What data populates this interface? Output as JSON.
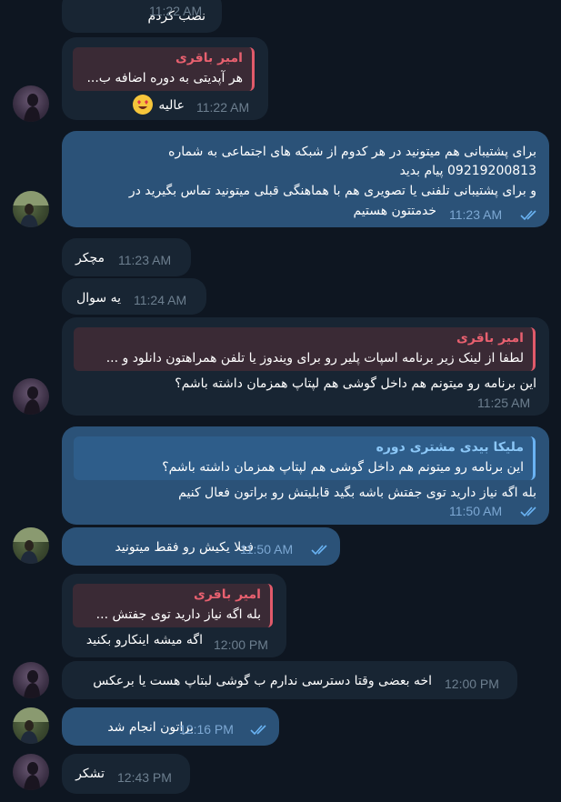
{
  "colors": {
    "background": "#0e1621",
    "incoming_bubble": "#182533",
    "outgoing_bubble": "#2b5278",
    "reply_name_red": "#e8606f",
    "reply_name_blue": "#8cc8f8",
    "time_incoming": "#6d7f8f",
    "time_outgoing": "#7da8d3"
  },
  "messages": [
    {
      "text": "نصب کردم",
      "time": "11:22 AM"
    },
    {
      "reply_name": "امیر باقری",
      "reply_text": "هر آپدیتی به دوره اضافه ب...",
      "text": "عالیه",
      "emoji": "smiling-face-heart-eyes",
      "time": "11:22 AM"
    },
    {
      "line1": "برای پشتیبانی هم میتونید در هر کدوم از شبکه های اجتماعی به شماره",
      "line2": "09219200813 پیام بدید",
      "line3": "و برای پشتیبانی تلفنی یا تصویری هم با هماهنگی قبلی میتونید تماس بگیرید در",
      "line4": "خدمتتون هستیم",
      "time": "11:23 AM"
    },
    {
      "text": "مچکر",
      "time": "11:23 AM"
    },
    {
      "text": "یه سوال",
      "time": "11:24 AM"
    },
    {
      "reply_name": "امیر باقری",
      "reply_text": "لطفا از لینک زیر برنامه اسپات پلیر رو برای ویندوز یا تلفن همراهتون دانلود و ...",
      "text": "این برنامه رو میتونم هم داخل گوشی هم لپتاپ همزمان داشته باشم؟",
      "time": "11:25 AM"
    },
    {
      "reply_name": "ملیکا بیدی مشتری دوره",
      "reply_text": "این برنامه رو میتونم هم داخل گوشی هم لپتاپ همزمان داشته باشم؟",
      "text": "بله اگه نیاز دارید توی جفتش باشه بگید قابلیتش رو براتون فعال کنیم",
      "time": "11:50 AM"
    },
    {
      "text": "فعلا یکیش رو فقط میتونید",
      "time": "11:50 AM"
    },
    {
      "reply_name": "امیر باقری",
      "reply_text": "بله اگه نیاز دارید توی جفتش ...",
      "text": "اگه میشه اینکارو بکنید",
      "time": "12:00 PM"
    },
    {
      "text": "اخه بعضی وقتا دسترسی ندارم ب گوشی لبتاپ هست یا برعکس",
      "time": "12:00 PM"
    },
    {
      "text": "براتون انجام شد",
      "time": "12:16 PM"
    },
    {
      "text": "تشکر",
      "time": "12:43 PM"
    }
  ]
}
